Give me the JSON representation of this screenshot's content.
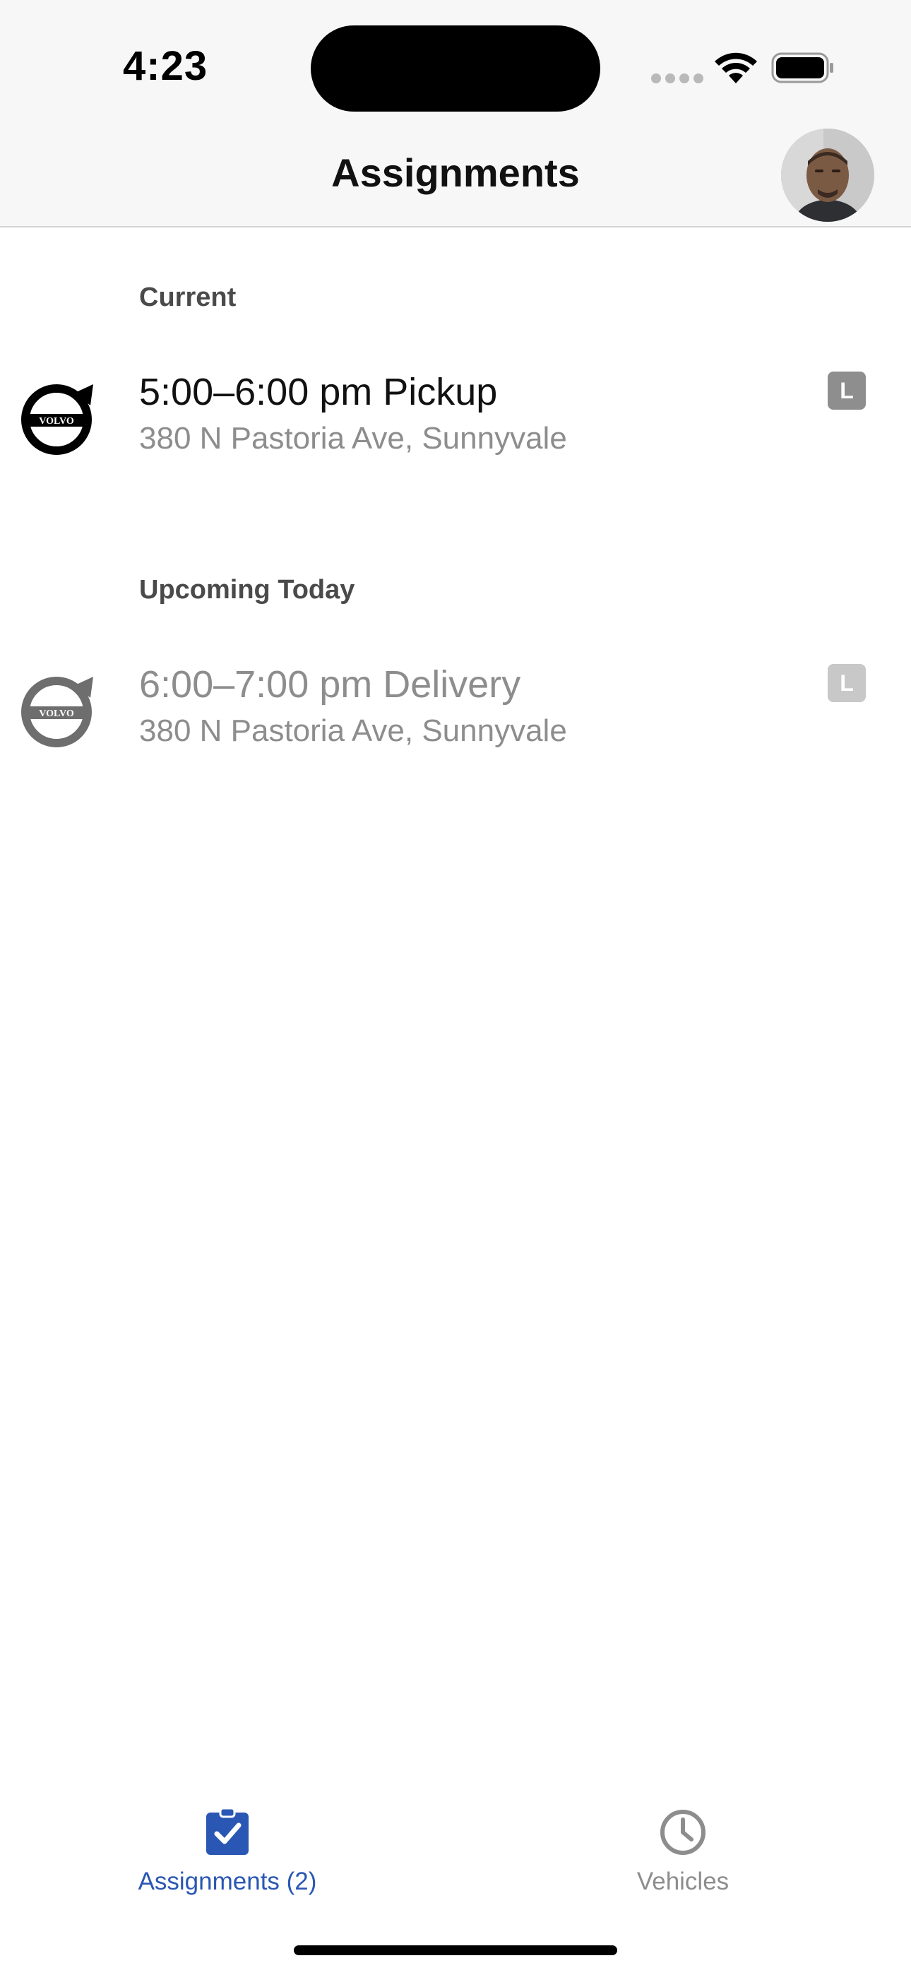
{
  "status_bar": {
    "time": "4:23"
  },
  "nav": {
    "title": "Assignments"
  },
  "sections": [
    {
      "header": "Current",
      "items": [
        {
          "title": "5:00–6:00 pm Pickup",
          "address": "380 N Pastoria Ave, Sunnyvale",
          "badge": "L",
          "logo_icon": "volvo-logo-icon"
        }
      ]
    },
    {
      "header": "Upcoming Today",
      "items": [
        {
          "title": "6:00–7:00 pm Delivery",
          "address": "380 N Pastoria Ave, Sunnyvale",
          "badge": "L",
          "logo_icon": "volvo-logo-icon"
        }
      ]
    }
  ],
  "tabbar": {
    "tabs": [
      {
        "label": "Assignments (2)",
        "icon": "clipboard-check-icon",
        "selected": true
      },
      {
        "label": "Vehicles",
        "icon": "clock-icon",
        "selected": false
      }
    ]
  },
  "colors": {
    "accent": "#2a57b3",
    "secondary_text": "#8d8d8d",
    "header_bg": "#f7f7f7"
  }
}
